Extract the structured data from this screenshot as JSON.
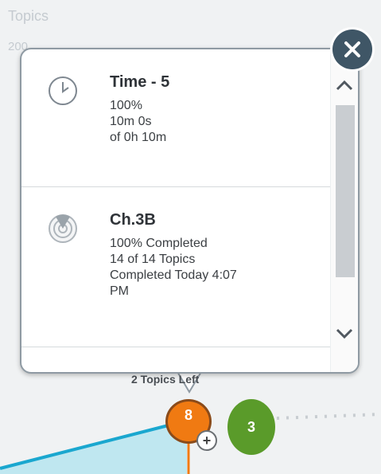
{
  "chart": {
    "topics_label": "Topics",
    "topics_count": "200",
    "topics_left": "2 Topics Left"
  },
  "popup": {
    "cards": [
      {
        "icon": "clock-icon",
        "title": "Time - 5",
        "lines": [
          "100%",
          "10m 0s",
          "of 0h 10m"
        ]
      },
      {
        "icon": "target-progress-icon",
        "title": "Ch.3B",
        "lines": [
          "100% Completed",
          "14 of 14 Topics",
          "Completed Today 4:07",
          "PM"
        ]
      }
    ],
    "scroll_up_icon": "chevron-up-icon",
    "scroll_down_icon": "chevron-down-icon"
  },
  "close_icon": "close-icon",
  "nodes": {
    "orange_badge": "8",
    "green_badge": "3",
    "add_icon": "plus-icon"
  },
  "colors": {
    "close_bg": "#3f5666",
    "orange": "#f07a12",
    "green": "#5a9b2a",
    "line_blue": "#1aa7cf"
  }
}
